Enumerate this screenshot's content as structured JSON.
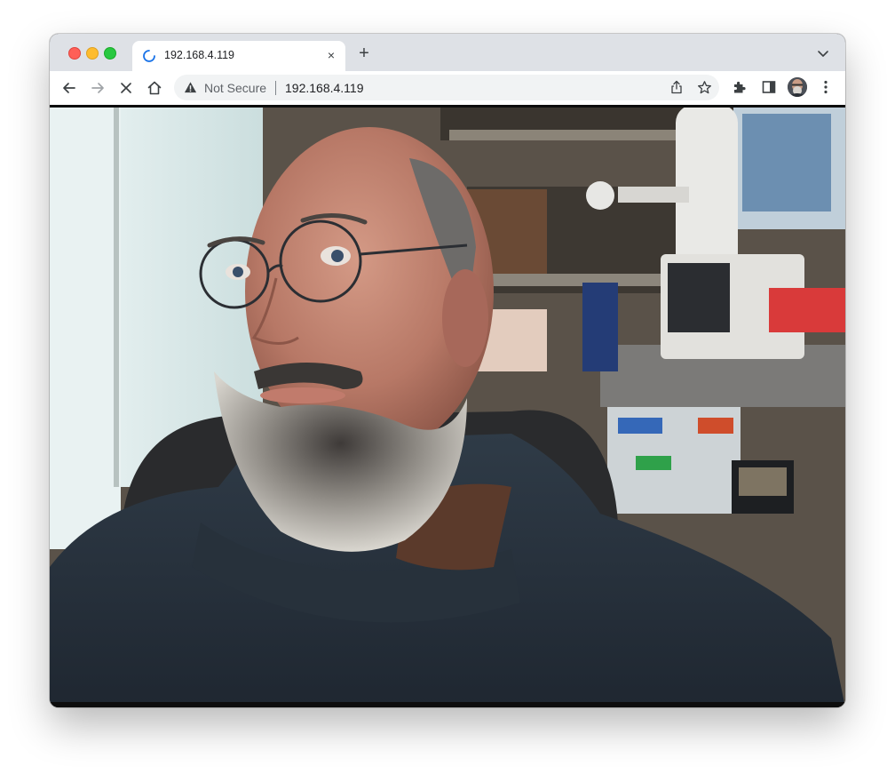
{
  "window": {
    "traffic_lights": [
      "close",
      "minimize",
      "zoom"
    ]
  },
  "tab": {
    "title": "192.168.4.119",
    "state_icon": "loading-spinner-icon",
    "close_glyph": "×"
  },
  "new_tab_glyph": "+",
  "toolbar": {
    "back_icon": "back-arrow-icon",
    "forward_icon": "forward-arrow-icon",
    "stop_icon": "stop-loading-icon",
    "home_icon": "home-icon"
  },
  "omnibox": {
    "security_label": "Not Secure",
    "url": "192.168.4.119"
  },
  "content": {
    "description_icon": "webcam-stream-image"
  },
  "colors": {
    "tabstrip": "#dee1e6",
    "omnibox": "#f1f3f4",
    "spinner": "#1a73e8"
  }
}
